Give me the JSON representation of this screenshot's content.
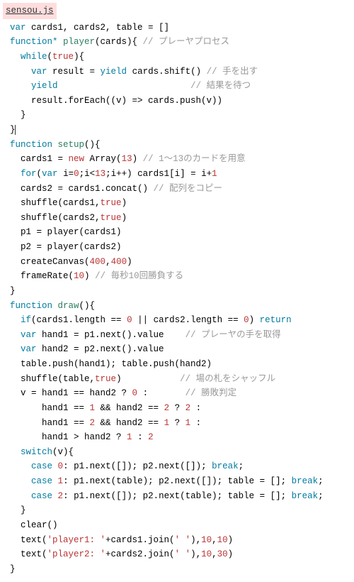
{
  "filename": "sensou.js",
  "code": {
    "l1": "var",
    "l1b": " cards1, cards2, table = []",
    "l2a": "function*",
    "l2b": " player",
    "l2c": "(cards){ ",
    "l2d": "// プレーヤプロセス",
    "l3a": "while",
    "l3b": "(",
    "l3c": "true",
    "l3d": "){",
    "l4a": "var",
    "l4b": " result = ",
    "l4c": "yield",
    "l4d": " cards.shift() ",
    "l4e": "// 手を出す",
    "l5a": "yield",
    "l5b": "                         ",
    "l5c": "// 結果を待つ",
    "l6": "result.forEach((v) => cards.push(v))",
    "l7": "}",
    "l8": "}",
    "l9a": "function",
    "l9b": " setup",
    "l9c": "(){",
    "l10a": "cards1 = ",
    "l10b": "new",
    "l10c": " Array(",
    "l10d": "13",
    "l10e": ") ",
    "l10f": "// 1〜13のカードを用意",
    "l11a": "for",
    "l11b": "(",
    "l11c": "var",
    "l11d": " i=",
    "l11e": "0",
    "l11f": ";i<",
    "l11g": "13",
    "l11h": ";i++) cards1[i] = i+",
    "l11i": "1",
    "l12a": "cards2 = cards1.concat() ",
    "l12b": "// 配列をコピー",
    "l13a": "shuffle(cards1,",
    "l13b": "true",
    "l13c": ")",
    "l14a": "shuffle(cards2,",
    "l14b": "true",
    "l14c": ")",
    "l15": "p1 = player(cards1)",
    "l16": "p2 = player(cards2)",
    "l17a": "createCanvas(",
    "l17b": "400",
    "l17c": ",",
    "l17d": "400",
    "l17e": ")",
    "l18a": "frameRate(",
    "l18b": "10",
    "l18c": ") ",
    "l18d": "// 毎秒10回勝負する",
    "l19": "}",
    "l20a": "function",
    "l20b": " draw",
    "l20c": "(){",
    "l21a": "if",
    "l21b": "(cards1.length == ",
    "l21c": "0",
    "l21d": " || cards2.length == ",
    "l21e": "0",
    "l21f": ") ",
    "l21g": "return",
    "l22a": "var",
    "l22b": " hand1 = p1.next().value    ",
    "l22c": "// プレーヤの手を取得",
    "l23a": "var",
    "l23b": " hand2 = p2.next().value",
    "l24": "table.push(hand1); table.push(hand2)",
    "l25a": "shuffle(table,",
    "l25b": "true",
    "l25c": ")           ",
    "l25d": "// 場の札をシャッフル",
    "l26a": "v = hand1 == hand2 ? ",
    "l26b": "0",
    "l26c": " :       ",
    "l26d": "// 勝敗判定",
    "l27a": "hand1 == ",
    "l27b": "1",
    "l27c": " && hand2 == ",
    "l27d": "2",
    "l27e": " ? ",
    "l27f": "2",
    "l27g": " :",
    "l28a": "hand1 == ",
    "l28b": "2",
    "l28c": " && hand2 == ",
    "l28d": "1",
    "l28e": " ? ",
    "l28f": "1",
    "l28g": " :",
    "l29a": "hand1 > hand2 ? ",
    "l29b": "1",
    "l29c": " : ",
    "l29d": "2",
    "l30a": "switch",
    "l30b": "(v){",
    "l31a": "case",
    "l31b": " ",
    "l31c": "0",
    "l31d": ": p1.next([]); p2.next([]); ",
    "l31e": "break",
    "l31f": ";",
    "l32a": "case",
    "l32b": " ",
    "l32c": "1",
    "l32d": ": p1.next(table); p2.next([]); table = []; ",
    "l32e": "break",
    "l32f": ";",
    "l33a": "case",
    "l33b": " ",
    "l33c": "2",
    "l33d": ": p1.next([]); p2.next(table); table = []; ",
    "l33e": "break",
    "l33f": ";",
    "l34": "}",
    "l35": "clear()",
    "l36a": "text(",
    "l36b": "'player1: '",
    "l36c": "+cards1.join(",
    "l36d": "' '",
    "l36e": "),",
    "l36f": "10",
    "l36g": ",",
    "l36h": "10",
    "l36i": ")",
    "l37a": "text(",
    "l37b": "'player2: '",
    "l37c": "+cards2.join(",
    "l37d": "' '",
    "l37e": "),",
    "l37f": "10",
    "l37g": ",",
    "l37h": "30",
    "l37i": ")",
    "l38": "}"
  }
}
